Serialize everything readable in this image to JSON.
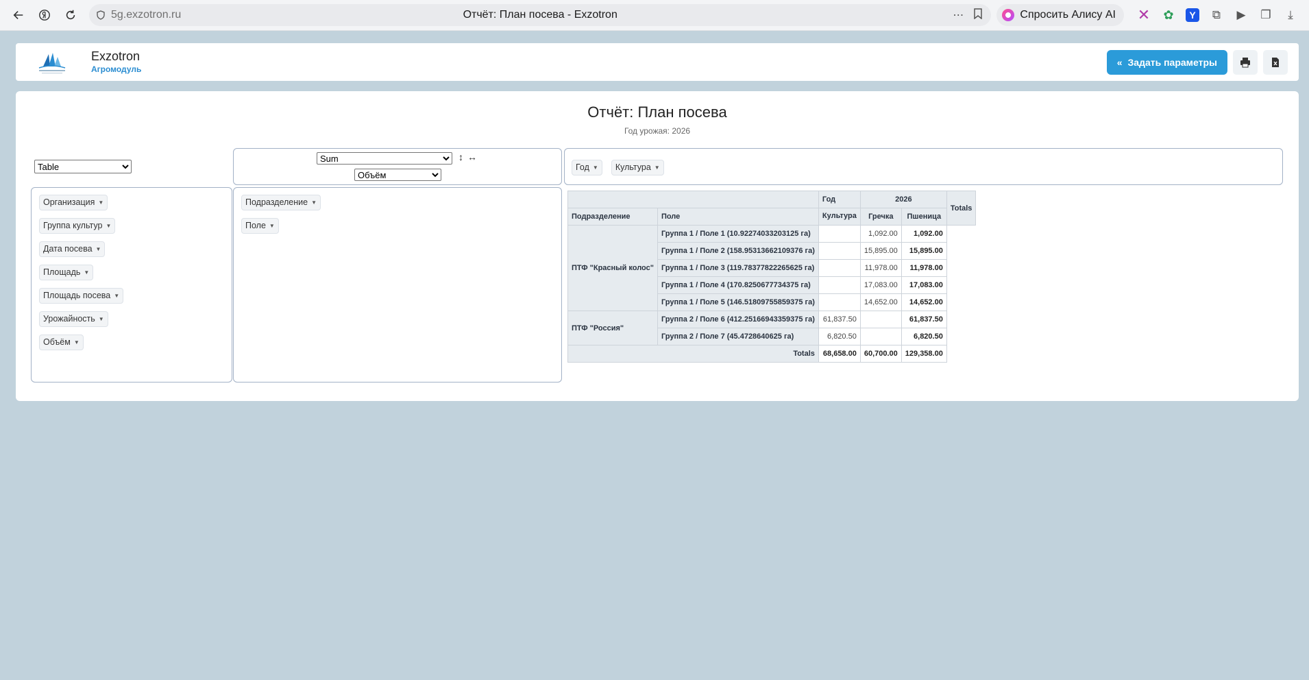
{
  "browser": {
    "url": "5g.exzotron.ru",
    "tab_title": "Отчёт: План посева - Exzotron",
    "alice_label": "Спросить Алису AI",
    "icons": [
      "back-icon",
      "yandex-icon",
      "reload-icon",
      "shield-icon",
      "more-icon",
      "bookmark-icon"
    ]
  },
  "header": {
    "brand": "Exzotron",
    "module": "Агромодуль",
    "params_button": "Задать параметры",
    "accent_color": "#2b9bd9"
  },
  "report": {
    "title": "Отчёт: План посева",
    "subtitle": "Год урожая: 2026",
    "renderer": "Table",
    "aggregator": "Sum",
    "value_field": "Объём",
    "unused_fields": [
      "Организация",
      "Группа культур",
      "Дата посева",
      "Площадь",
      "Площадь посева",
      "Урожайность",
      "Объём"
    ],
    "row_fields": [
      "Подразделение",
      "Поле"
    ],
    "col_fields": [
      "Год",
      "Культура"
    ]
  },
  "pivot": {
    "col_header_year_label": "Год",
    "col_header_crop_label": "Культура",
    "year": "2026",
    "crops": [
      "Гречка",
      "Пшеница"
    ],
    "totals_label": "Totals",
    "row_header_division": "Подразделение",
    "row_header_field": "Поле",
    "groups": [
      {
        "division": "ПТФ \"Красный колос\"",
        "rows": [
          {
            "field": "Группа 1 / Поле 1 (10.92274033203125 га)",
            "grechka": "",
            "pshenitsa": "1,092.00",
            "total": "1,092.00"
          },
          {
            "field": "Группа 1 / Поле 2 (158.95313662109376 га)",
            "grechka": "",
            "pshenitsa": "15,895.00",
            "total": "15,895.00"
          },
          {
            "field": "Группа 1 / Поле 3 (119.78377822265625 га)",
            "grechka": "",
            "pshenitsa": "11,978.00",
            "total": "11,978.00"
          },
          {
            "field": "Группа 1 / Поле 4 (170.8250677734375 га)",
            "grechka": "",
            "pshenitsa": "17,083.00",
            "total": "17,083.00"
          },
          {
            "field": "Группа 1 / Поле 5 (146.51809755859375 га)",
            "grechka": "",
            "pshenitsa": "14,652.00",
            "total": "14,652.00"
          }
        ]
      },
      {
        "division": "ПТФ \"Россия\"",
        "rows": [
          {
            "field": "Группа 2 / Поле 6 (412.25166943359375 га)",
            "grechka": "61,837.50",
            "pshenitsa": "",
            "total": "61,837.50"
          },
          {
            "field": "Группа 2 / Поле 7 (45.4728640625 га)",
            "grechka": "6,820.50",
            "pshenitsa": "",
            "total": "6,820.50"
          }
        ]
      }
    ],
    "col_totals": {
      "grechka": "68,658.00",
      "pshenitsa": "60,700.00",
      "total": "129,358.00"
    }
  }
}
